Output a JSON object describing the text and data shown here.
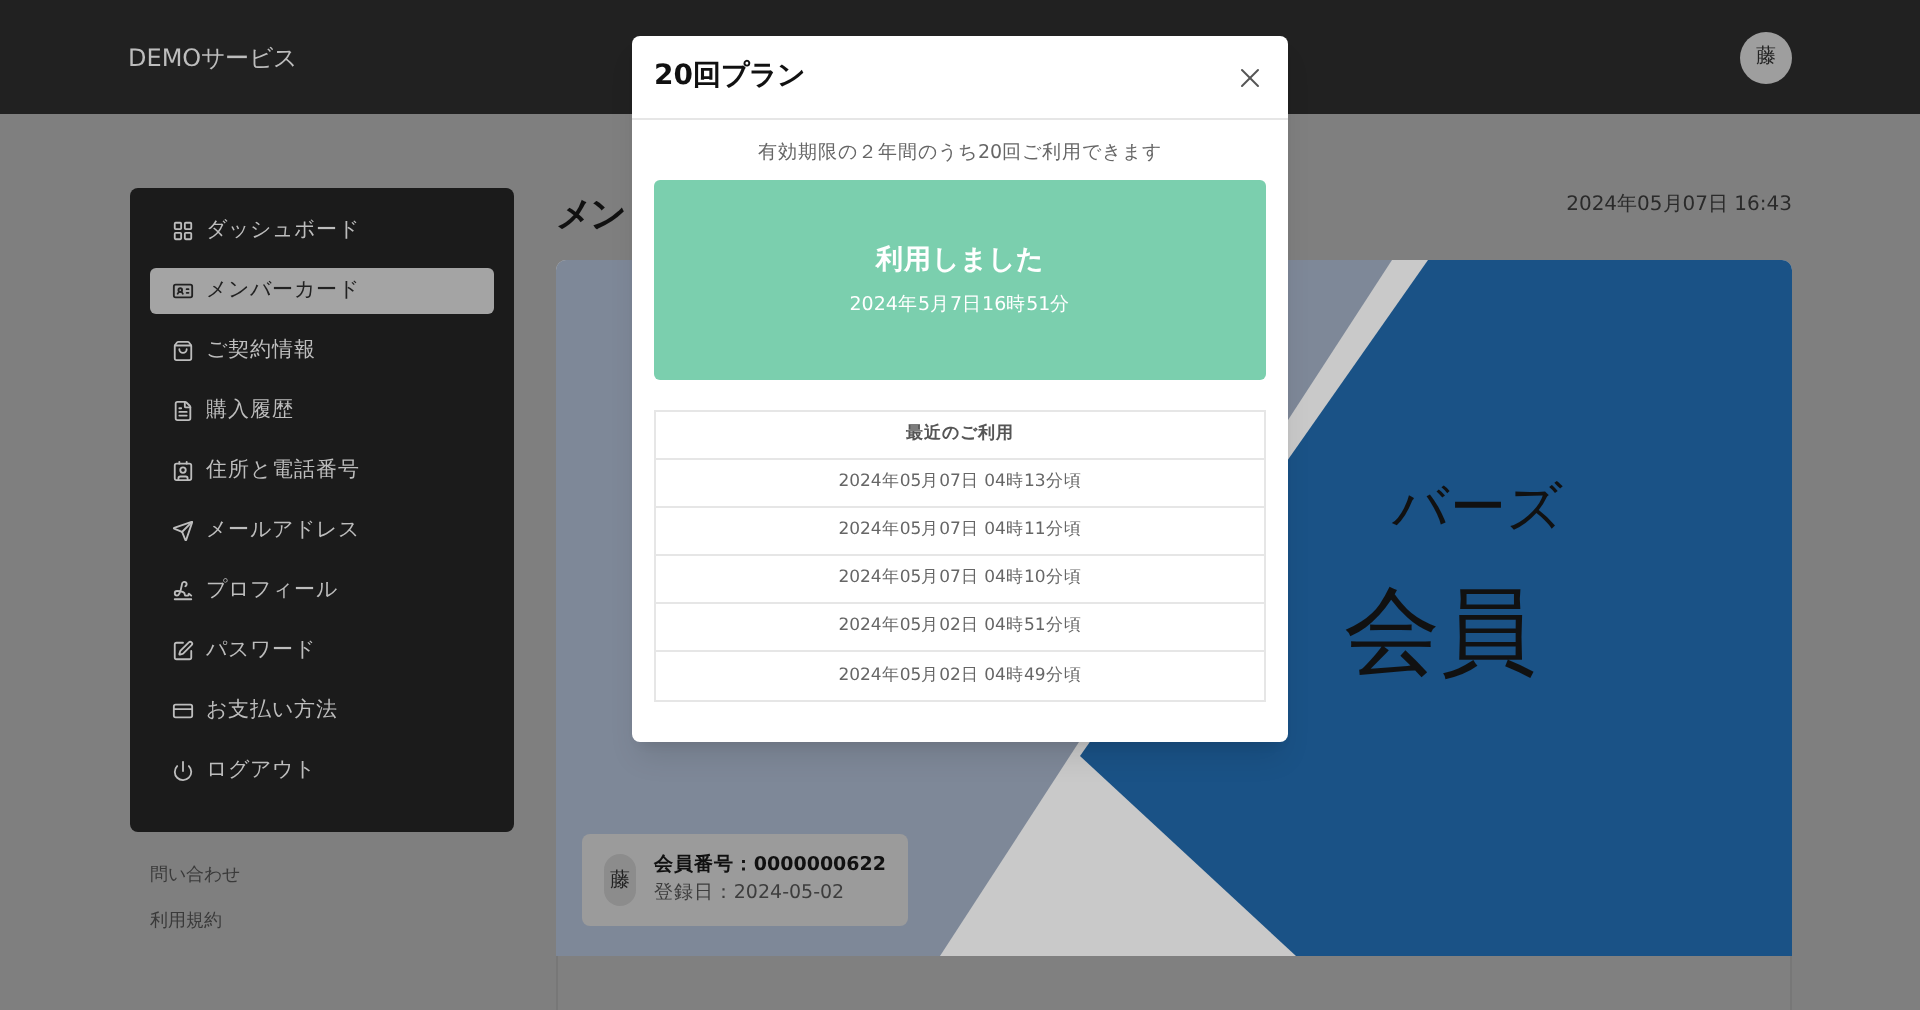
{
  "header": {
    "brand": "DEMOサービス",
    "avatar": "藤"
  },
  "sidebar": {
    "items": [
      {
        "label": "ダッシュボード",
        "selected": false
      },
      {
        "label": "メンバーカード",
        "selected": true
      },
      {
        "label": "ご契約情報",
        "selected": false
      },
      {
        "label": "購入履歴",
        "selected": false
      },
      {
        "label": "住所と電話番号",
        "selected": false
      },
      {
        "label": "メールアドレス",
        "selected": false
      },
      {
        "label": "プロフィール",
        "selected": false
      },
      {
        "label": "パスワード",
        "selected": false
      },
      {
        "label": "お支払い方法",
        "selected": false
      },
      {
        "label": "ログアウト",
        "selected": false
      }
    ],
    "links": [
      "問い合わせ",
      "利用規約"
    ]
  },
  "page": {
    "title": "メン",
    "datetime": "2024年05月07日 16:43"
  },
  "card": {
    "subtitle": "バーズ",
    "title": "会員",
    "member": {
      "avatar": "藤",
      "number": "会員番号：0000000622",
      "registered": "登録日：2024-05-02"
    }
  },
  "modal": {
    "title": "20回プラン",
    "description": "有効期限の２年間のうち20回ご利用できます",
    "status": {
      "label": "利用しました",
      "time": "2024年5月7日16時51分"
    },
    "history": {
      "heading": "最近のご利用",
      "rows": [
        "2024年05月07日 04時13分頃",
        "2024年05月07日 04時11分頃",
        "2024年05月07日 04時10分頃",
        "2024年05月02日 04時51分頃",
        "2024年05月02日 04時49分頃"
      ]
    }
  }
}
